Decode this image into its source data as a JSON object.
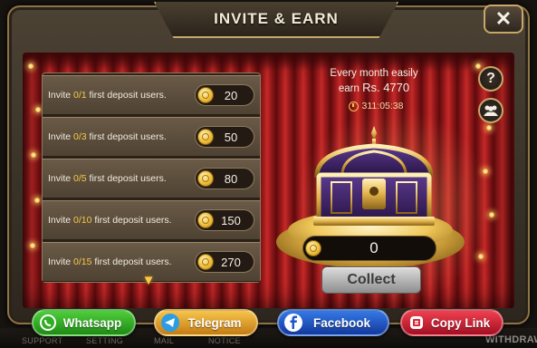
{
  "background": {
    "bottom_labels": [
      "SUPPORT",
      "SETTING",
      "MAIL",
      "NOTICE",
      "WITHDRAW"
    ]
  },
  "modal": {
    "title": "INVITE & EARN",
    "close_label": "✕"
  },
  "tasks": [
    {
      "prefix": "Invite ",
      "progress": "0/1",
      "suffix": " first deposit users.",
      "reward": "20"
    },
    {
      "prefix": "Invite ",
      "progress": "0/3",
      "suffix": " first deposit users.",
      "reward": "50"
    },
    {
      "prefix": "Invite ",
      "progress": "0/5",
      "suffix": " first deposit users.",
      "reward": "80"
    },
    {
      "prefix": "Invite ",
      "progress": "0/10",
      "suffix": " first deposit users.",
      "reward": "150"
    },
    {
      "prefix": "Invite ",
      "progress": "0/15",
      "suffix": " first deposit users.",
      "reward": "270"
    }
  ],
  "earnings": {
    "line1": "Every month easily",
    "line2_prefix": "earn ",
    "amount": "Rs. 4770",
    "timer": "311:05:38"
  },
  "chest": {
    "counter_value": "0",
    "collect_label": "Collect"
  },
  "icons": {
    "help": "?",
    "more": "chevron-down-icon"
  },
  "share": {
    "whatsapp": "Whatsapp",
    "telegram": "Telegram",
    "facebook": "Facebook",
    "copylink": "Copy Link"
  },
  "colors": {
    "gold": "#c9a76a",
    "progress_yellow": "#f3c94a",
    "curtain_red": "#9d1a1c",
    "whatsapp_green": "#2fae22",
    "telegram_orange": "#e09a2a",
    "facebook_blue": "#1f57c4",
    "copylink_red": "#d42a3a"
  }
}
